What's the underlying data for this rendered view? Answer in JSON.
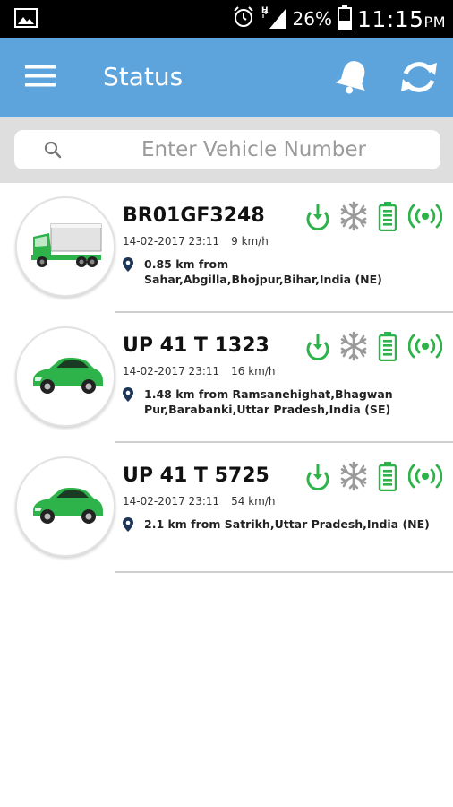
{
  "status_bar": {
    "battery": "26%",
    "time": "11:15",
    "ampm": "PM"
  },
  "app_bar": {
    "title": "Status"
  },
  "search": {
    "placeholder": "Enter Vehicle Number"
  },
  "vehicles": [
    {
      "plate": "BR01GF3248",
      "datetime": "14-02-2017 23:11",
      "speed": "9 km/h",
      "location": "0.85 km from Sahar,Abgilla,Bhojpur,Bihar,India (NE)",
      "type": "truck"
    },
    {
      "plate": "UP 41 T 1323",
      "datetime": "14-02-2017 23:11",
      "speed": "16 km/h",
      "location": "1.48 km from Ramsanehighat,Bhagwan Pur,Barabanki,Uttar Pradesh,India (SE)",
      "type": "car"
    },
    {
      "plate": "UP 41 T 5725",
      "datetime": "14-02-2017 23:11",
      "speed": "54 km/h",
      "location": "2.1 km from Satrikh,Uttar Pradesh,India (NE)",
      "type": "car"
    }
  ],
  "icons": [
    "image-icon",
    "alarm-icon",
    "signal-icon",
    "battery-icon",
    "menu-icon",
    "bell-icon",
    "refresh-icon",
    "search-icon",
    "ignition-icon",
    "ac-snowflake-icon",
    "vehicle-battery-icon",
    "gps-signal-icon",
    "location-pin-icon",
    "truck-icon",
    "car-icon"
  ],
  "colors": {
    "app_bar": "#5ea4dc",
    "status_green": "#2db34a",
    "icon_grey": "#9a9a9a",
    "search_bg": "#dedede"
  }
}
